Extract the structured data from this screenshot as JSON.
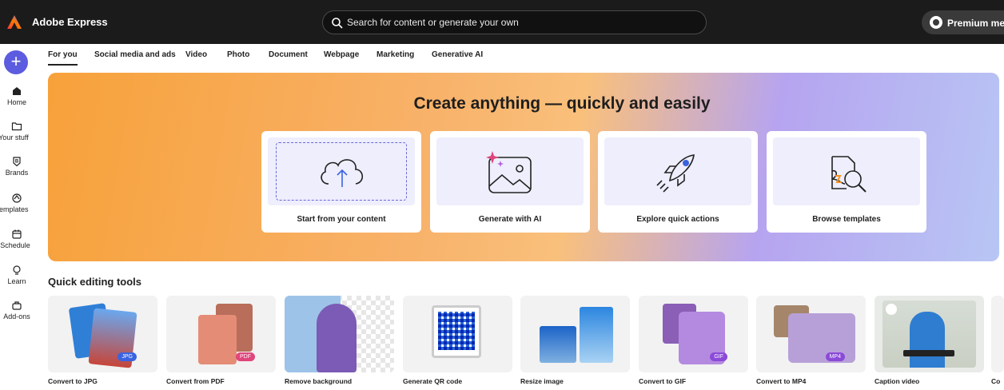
{
  "app": {
    "title": "Adobe Express"
  },
  "search": {
    "placeholder": "Search for content or generate your own"
  },
  "premium": {
    "label": "Premium mer"
  },
  "rail": {
    "add_label": "+",
    "items": [
      {
        "label": "Home",
        "icon": "home-icon"
      },
      {
        "label": "Your stuff",
        "icon": "folder-icon"
      },
      {
        "label": "Brands",
        "icon": "brand-icon"
      },
      {
        "label": "Templates",
        "icon": "templates-icon"
      },
      {
        "label": "Schedule",
        "icon": "calendar-icon"
      },
      {
        "label": "Learn",
        "icon": "lightbulb-icon"
      },
      {
        "label": "Add-ons",
        "icon": "bag-icon"
      }
    ]
  },
  "tabs": [
    {
      "label": "For you",
      "active": true
    },
    {
      "label": "Social media and ads"
    },
    {
      "label": "Video"
    },
    {
      "label": "Photo"
    },
    {
      "label": "Document"
    },
    {
      "label": "Webpage"
    },
    {
      "label": "Marketing"
    },
    {
      "label": "Generative AI"
    }
  ],
  "hero": {
    "title": "Create anything — quickly and easily",
    "cards": [
      {
        "label": "Start from your content",
        "icon": "cloud-upload-icon"
      },
      {
        "label": "Generate with AI",
        "icon": "ai-image-icon"
      },
      {
        "label": "Explore quick actions",
        "icon": "rocket-icon"
      },
      {
        "label": "Browse templates",
        "icon": "template-search-icon"
      }
    ]
  },
  "quick_tools": {
    "title": "Quick editing tools",
    "items": [
      {
        "label": "Convert to JPG",
        "badge": "JPG"
      },
      {
        "label": "Convert from PDF",
        "badge": "PDF"
      },
      {
        "label": "Remove background"
      },
      {
        "label": "Generate QR code"
      },
      {
        "label": "Resize image"
      },
      {
        "label": "Convert to GIF",
        "badge": "GIF"
      },
      {
        "label": "Convert to MP4",
        "badge": "MP4"
      },
      {
        "label": "Caption video"
      },
      {
        "label": "Co"
      }
    ]
  },
  "colors": {
    "accent": "#5c5ce0",
    "topbar": "#1b1b1b"
  }
}
